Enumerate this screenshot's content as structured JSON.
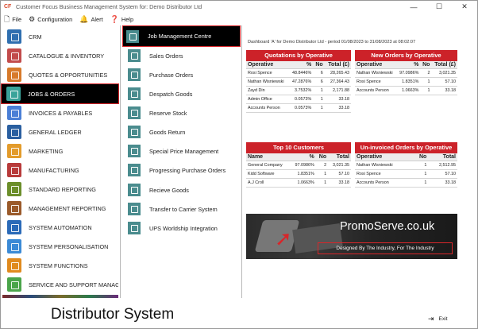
{
  "window": {
    "logo": "CF",
    "title": "Customer Focus Business Management System for: Demo Distributor Ltd",
    "controls": [
      "—",
      "☐",
      "✕"
    ]
  },
  "menu": [
    {
      "icon": "file-icon",
      "glyph": "🗋",
      "label": "File"
    },
    {
      "icon": "gear-icon",
      "glyph": "⚙",
      "label": "Configuration"
    },
    {
      "icon": "bell-icon",
      "glyph": "🔔",
      "label": "Alert"
    },
    {
      "icon": "help-icon",
      "glyph": "❓",
      "label": "Help"
    }
  ],
  "modules": [
    {
      "label": "CRM",
      "color": "#2f6fb0",
      "selected": false
    },
    {
      "label": "CATALOGUE & INVENTORY",
      "color": "#c24b4b",
      "selected": false
    },
    {
      "label": "QUOTES & OPPORTUNITIES",
      "color": "#d77a2a",
      "selected": false
    },
    {
      "label": "JOBS & ORDERS",
      "color": "#3aa39a",
      "selected": true
    },
    {
      "label": "INVOICES & PAYABLES",
      "color": "#4a7fd6",
      "selected": false
    },
    {
      "label": "GENERAL LEDGER",
      "color": "#2a5fa0",
      "selected": false
    },
    {
      "label": "MARKETING",
      "color": "#e39b2b",
      "selected": false
    },
    {
      "label": "MANUFACTURING",
      "color": "#b83a3a",
      "selected": false
    },
    {
      "label": "STANDARD REPORTING",
      "color": "#6b8e2a",
      "selected": false
    },
    {
      "label": "MANAGEMENT REPORTING",
      "color": "#9a5a2a",
      "selected": false
    },
    {
      "label": "SYSTEM AUTOMATION",
      "color": "#2a6ab8",
      "selected": false
    },
    {
      "label": "SYSTEM PERSONALISATION",
      "color": "#3b8ad6",
      "selected": false
    },
    {
      "label": "SYSTEM FUNCTIONS",
      "color": "#e08a1e",
      "selected": false
    },
    {
      "label": "SERVICE AND SUPPORT MANAGI",
      "color": "#4aa44a",
      "selected": false
    }
  ],
  "submenu": [
    {
      "label": "Job Management Centre",
      "selected": true
    },
    {
      "label": "Sales Orders",
      "selected": false
    },
    {
      "label": "Purchase Orders",
      "selected": false
    },
    {
      "label": "Despatch Goods",
      "selected": false
    },
    {
      "label": "Reserve Stock",
      "selected": false
    },
    {
      "label": "Goods Return",
      "selected": false
    },
    {
      "label": "Special Price Management",
      "selected": false
    },
    {
      "label": "Progressing Purchase Orders",
      "selected": false
    },
    {
      "label": "Recieve Goods",
      "selected": false
    },
    {
      "label": "Transfer to Carrier System",
      "selected": false
    },
    {
      "label": "UPS Worldship Integration",
      "selected": false
    }
  ],
  "dashboard": {
    "title": "Dashboard 'A' for Demo Distributor Ltd - period 01/08/2023 to 31/08/2023 at 08:02:07",
    "quotations": {
      "heading": "Quotations by Operative",
      "cols": [
        "Operative",
        "%",
        "No",
        "Total (£)"
      ],
      "rows": [
        [
          "Rosi Spence",
          "48.8446%",
          "6",
          "28,265.43"
        ],
        [
          "Nathan Wisniewski",
          "47.2876%",
          "6",
          "27,364.43"
        ],
        [
          "Zayd Din",
          "3.7532%",
          "1",
          "2,171.88"
        ],
        [
          "Admin Office",
          "0.0573%",
          "1",
          "33.18"
        ],
        [
          "Accounts Person",
          "0.0573%",
          "1",
          "33.18"
        ]
      ]
    },
    "new_orders": {
      "heading": "New Orders by Operative",
      "cols": [
        "Operative",
        "%",
        "No",
        "Total (£)"
      ],
      "rows": [
        [
          "Nathan Wisniewski",
          "97.0986%",
          "2",
          "3,021.35"
        ],
        [
          "Rosi Spence",
          "1.8351%",
          "1",
          "57.10"
        ],
        [
          "Accounts Person",
          "1.0663%",
          "1",
          "33.18"
        ]
      ]
    },
    "top_customers": {
      "heading": "Top 10 Customers",
      "cols": [
        "Name",
        "%",
        "No",
        "Total"
      ],
      "rows": [
        [
          "General Company",
          "97.0986%",
          "2",
          "3,021.35"
        ],
        [
          "Kidd Software",
          "1.8351%",
          "1",
          "57.10"
        ],
        [
          "A.J Croll",
          "1.0663%",
          "1",
          "33.18"
        ]
      ]
    },
    "uninvoiced": {
      "heading": "Un-invoiced Orders by Operative",
      "cols": [
        "Operative",
        "No",
        "Total"
      ],
      "rows": [
        [
          "Nathan Wisniewski",
          "1",
          "2,512.95"
        ],
        [
          "Rosi Spence",
          "1",
          "57.10"
        ],
        [
          "Accounts Person",
          "1",
          "33.18"
        ]
      ]
    },
    "banner": {
      "brand": "PromoServe.co.uk",
      "tagline": "Designed By The Industry, For The Industry"
    }
  },
  "footer": {
    "title": "Distributor System",
    "exit_label": "Exit",
    "exit_icon": "exit-icon"
  }
}
